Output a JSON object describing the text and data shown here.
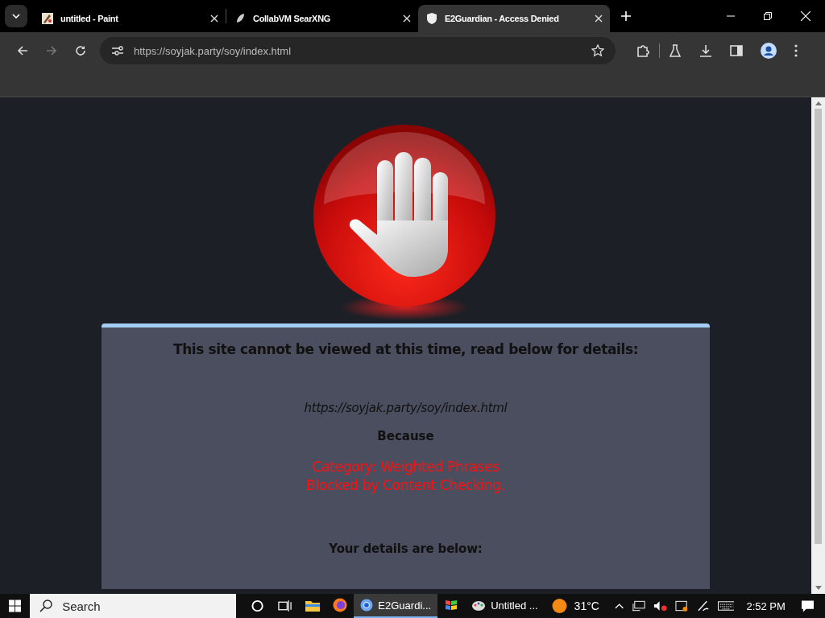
{
  "browser": {
    "tabs": [
      {
        "title": "untitled - Paint",
        "kind": "paint",
        "selected": false
      },
      {
        "title": "CollabVM SearXNG",
        "kind": "searx",
        "selected": false
      },
      {
        "title": "E2Guardian - Access Denied",
        "kind": "shield",
        "selected": true
      }
    ],
    "address": "https://soyjak.party/soy/index.html"
  },
  "page": {
    "heading": "This site cannot be viewed at this time, read below for details:",
    "url": "https://soyjak.party/soy/index.html",
    "because": "Because",
    "reasons": [
      "Category: Weighted Phrases",
      "Blocked by Content Checking."
    ],
    "details_heading": "Your details are below:"
  },
  "taskbar": {
    "search_placeholder": "Search",
    "apps": [
      {
        "kind": "explorer",
        "selected": false
      },
      {
        "kind": "firefox",
        "selected": false
      },
      {
        "kind": "chrome",
        "label": "E2Guardi...",
        "selected": true
      },
      {
        "kind": "winflag",
        "selected": false
      },
      {
        "kind": "paint",
        "label": "Untitled ...",
        "selected": false
      }
    ],
    "temperature": "31°C",
    "time": "2:52 PM"
  }
}
